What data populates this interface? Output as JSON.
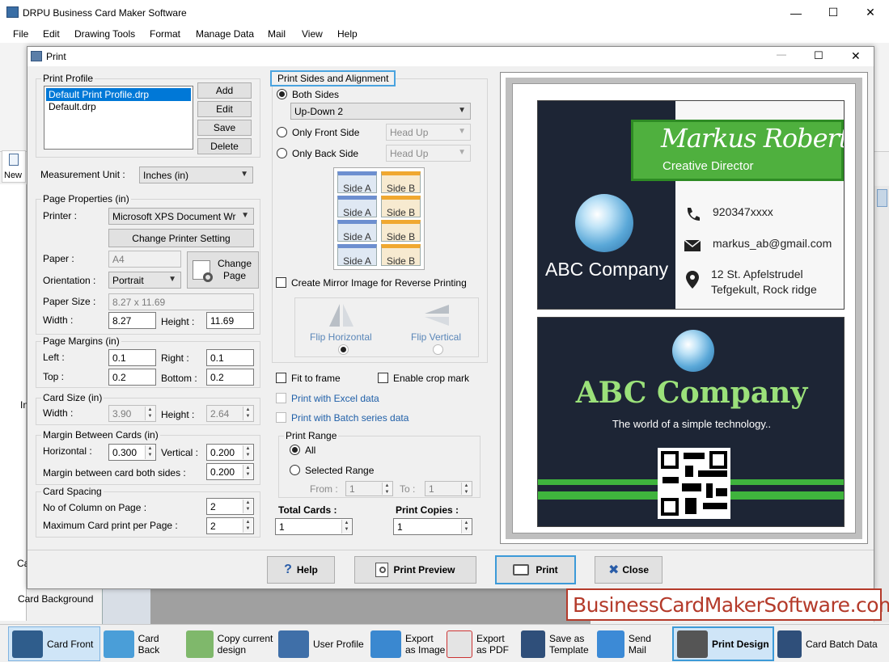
{
  "app": {
    "title": "DRPU Business Card Maker Software",
    "menu": [
      "File",
      "Edit",
      "Drawing Tools",
      "Format",
      "Manage Data",
      "Mail",
      "View",
      "Help"
    ],
    "new_label": "New",
    "card_background": "Card Background",
    "left_clipped": [
      "In",
      "Ca"
    ]
  },
  "dialog": {
    "title": "Print",
    "print_profile": {
      "label": "Print Profile",
      "items": [
        "Default Print Profile.drp",
        "Default.drp"
      ],
      "buttons": [
        "Add",
        "Edit",
        "Save",
        "Delete"
      ]
    },
    "measurement_unit": {
      "label": "Measurement Unit :",
      "value": "Inches (in)"
    },
    "page_properties": {
      "label": "Page Properties (in)",
      "printer_label": "Printer :",
      "printer_value": "Microsoft XPS Document Wr",
      "change_printer": "Change Printer Setting",
      "paper_label": "Paper :",
      "paper_value": "A4",
      "change_page": "Change Page",
      "orientation_label": "Orientation :",
      "orientation_value": "Portrait",
      "paper_size_label": "Paper Size :",
      "paper_size_value": "8.27 x 11.69",
      "width_label": "Width :",
      "width_value": "8.27",
      "height_label": "Height :",
      "height_value": "11.69"
    },
    "page_margins": {
      "label": "Page Margins (in)",
      "left_label": "Left :",
      "left_value": "0.1",
      "right_label": "Right :",
      "right_value": "0.1",
      "top_label": "Top :",
      "top_value": "0.2",
      "bottom_label": "Bottom :",
      "bottom_value": "0.2"
    },
    "card_size": {
      "label": "Card Size (in)",
      "width_label": "Width :",
      "width_value": "3.90",
      "height_label": "Height :",
      "height_value": "2.64"
    },
    "margin_between": {
      "label": "Margin Between Cards (in)",
      "horizontal_label": "Horizontal :",
      "horizontal_value": "0.300",
      "vertical_label": "Vertical :",
      "vertical_value": "0.200",
      "both_label": "Margin between card both sides :",
      "both_value": "0.200"
    },
    "card_spacing": {
      "label": "Card Spacing",
      "columns_label": "No of Column on Page :",
      "columns_value": "2",
      "max_label": "Maximum Card print per Page :",
      "max_value": "2"
    },
    "print_sides": {
      "label": "Print Sides and Alignment",
      "both_sides": "Both Sides",
      "both_combo": "Up-Down 2",
      "front_side": "Only Front Side",
      "front_combo": "Head Up",
      "back_side": "Only Back Side",
      "back_combo": "Head Up",
      "side_a": "Side A",
      "side_b": "Side B",
      "mirror": "Create Mirror Image for Reverse Printing",
      "flip_h": "Flip Horizontal",
      "flip_v": "Flip Vertical"
    },
    "options": {
      "fit_to_frame": "Fit to frame",
      "crop_mark": "Enable crop mark",
      "excel": "Print with Excel data",
      "batch": "Print with Batch series data"
    },
    "print_range": {
      "label": "Print Range",
      "all": "All",
      "selected": "Selected Range",
      "from_label": "From :",
      "from_value": "1",
      "to_label": "To :",
      "to_value": "1"
    },
    "total_cards": {
      "label": "Total Cards :",
      "value": "1"
    },
    "print_copies": {
      "label": "Print Copies :",
      "value": "1"
    },
    "buttons": {
      "help": "Help",
      "preview": "Print Preview",
      "print": "Print",
      "close": "Close"
    }
  },
  "card_front": {
    "name": "Markus Robert",
    "role": "Creative Director",
    "company": "ABC Company",
    "phone": "920347xxxx",
    "email": "markus_ab@gmail.com",
    "address1": "12 St. Apfelstrudel",
    "address2": "Tefgekult, Rock ridge"
  },
  "card_back": {
    "company": "ABC Company",
    "tagline": "The world of a simple technology.."
  },
  "watermark": "BusinessCardMakerSoftware.com",
  "bottom_bar": [
    {
      "label": "Card Front",
      "icon": "card-front-icon"
    },
    {
      "label": "Card Back",
      "icon": "card-back-icon"
    },
    {
      "label": "Copy current design",
      "icon": "copy-design-icon"
    },
    {
      "label": "User Profile",
      "icon": "user-profile-icon"
    },
    {
      "label": "Export as Image",
      "icon": "export-image-icon"
    },
    {
      "label": "Export as PDF",
      "icon": "export-pdf-icon"
    },
    {
      "label": "Save as Template",
      "icon": "save-template-icon"
    },
    {
      "label": "Send Mail",
      "icon": "send-mail-icon"
    },
    {
      "label": "Print Design",
      "icon": "print-design-icon"
    },
    {
      "label": "Card Batch Data",
      "icon": "card-batch-icon"
    }
  ],
  "colors": {
    "card_dark": "#1d2535",
    "card_green": "#4fb03e",
    "company_green": "#9be17a",
    "accent_blue": "#0078d7",
    "watermark_red": "#b43a2a"
  }
}
